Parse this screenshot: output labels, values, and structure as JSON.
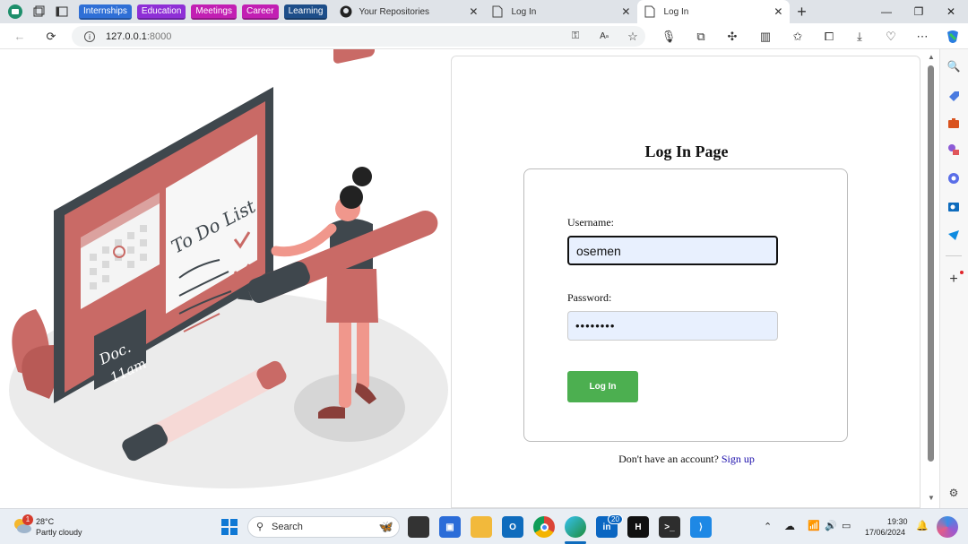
{
  "browser": {
    "bookmarks": [
      {
        "label": "Internships",
        "color": "#2f6fd6"
      },
      {
        "label": "Education",
        "color": "#8e2fd6"
      },
      {
        "label": "Meetings",
        "color": "#c21fb3"
      },
      {
        "label": "Career",
        "color": "#c21fb3"
      },
      {
        "label": "Learning",
        "color": "#1d4e89"
      }
    ],
    "tabs": [
      {
        "label": "Your Repositories",
        "icon": "github-icon"
      },
      {
        "label": "Log In",
        "icon": "page-icon"
      },
      {
        "label": "Log In",
        "icon": "page-icon",
        "active": true
      }
    ],
    "url_host": "127.0.0.1",
    "url_port": ":8000"
  },
  "page": {
    "title": "Log In Page",
    "username_label": "Username:",
    "username_value": "osemen",
    "password_label": "Password:",
    "password_value": "••••••••",
    "login_button": "Log In",
    "signup_prompt": "Don't have an account?",
    "signup_link": "Sign up"
  },
  "illustration": {
    "todo_title": "To Do List",
    "note_line1": "Doc.",
    "note_line2": "11am"
  },
  "taskbar": {
    "weather_temp": "28°C",
    "weather_desc": "Partly cloudy",
    "weather_badge": "1",
    "search_placeholder": "Search",
    "linkedin_badge": "20",
    "time": "19:30",
    "date": "17/06/2024"
  },
  "colors": {
    "accent_green": "#4caf50",
    "illustration_red": "#c96a66",
    "board_dark": "#3f474d",
    "link_blue": "#1a0dab"
  }
}
